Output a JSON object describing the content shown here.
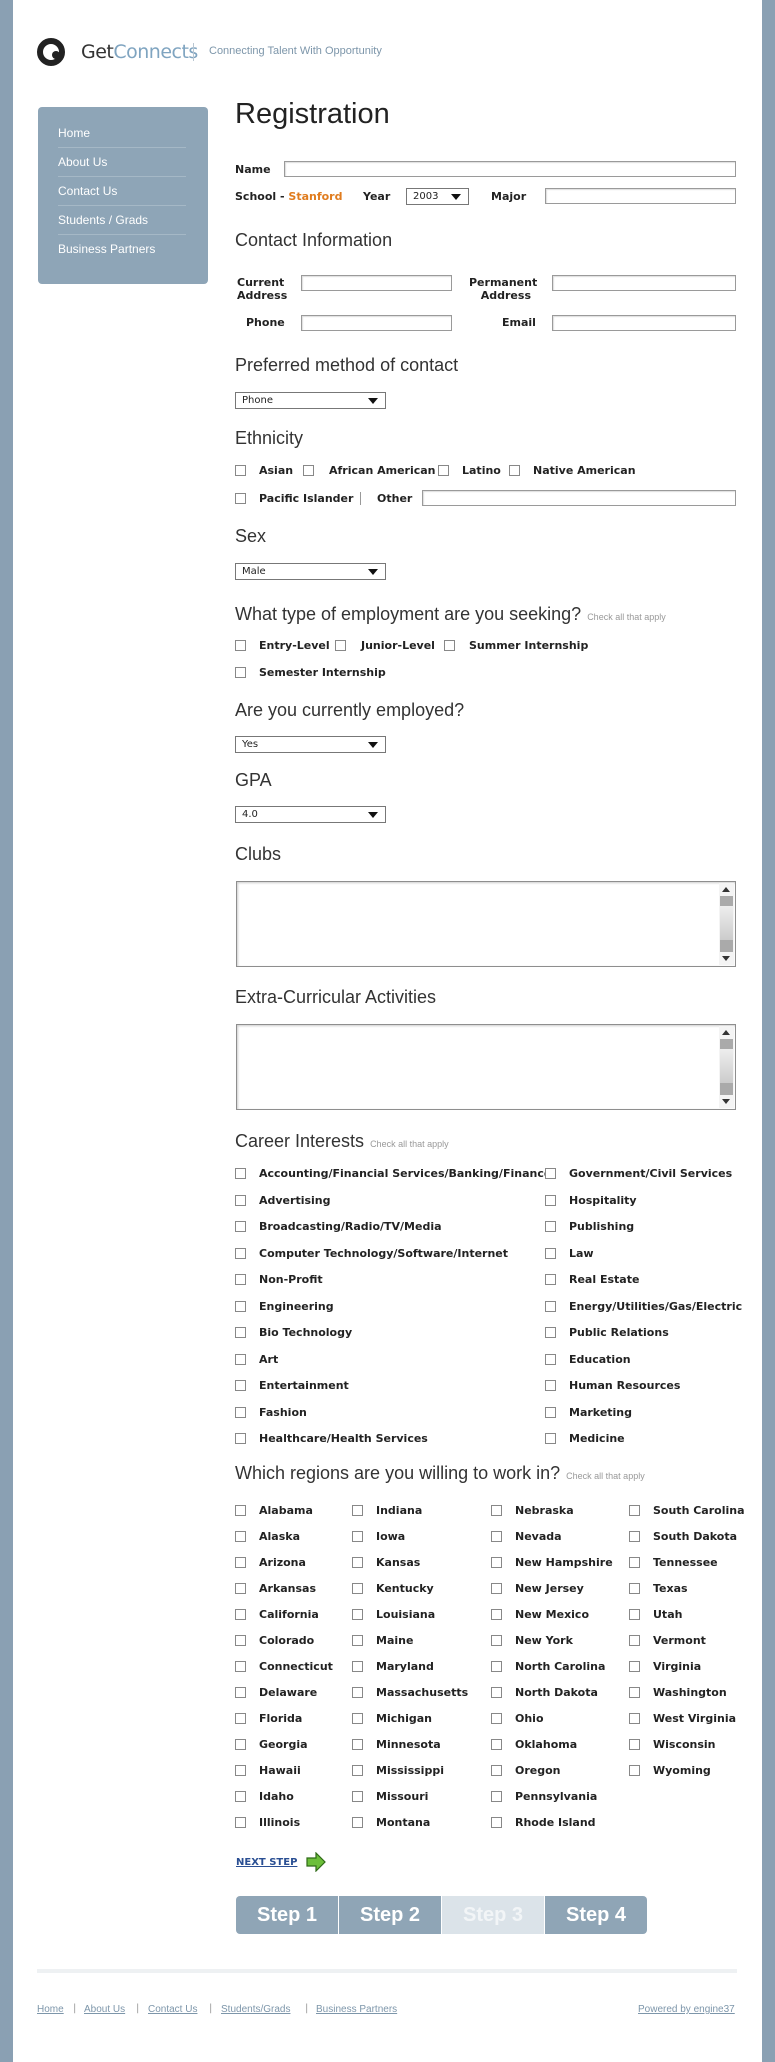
{
  "brand": {
    "logo_get": "Get",
    "logo_connects": "Connects",
    "tagline": "Connecting Talent With Opportunity"
  },
  "sidebar": {
    "items": [
      {
        "label": "Home"
      },
      {
        "label": "About Us"
      },
      {
        "label": "Contact Us"
      },
      {
        "label": "Students / Grads"
      },
      {
        "label": "Business Partners"
      }
    ]
  },
  "form": {
    "title": "Registration",
    "name_label": "Name",
    "school_label": "School - ",
    "school_value": "Stanford",
    "year_label": "Year",
    "year_value": "2003",
    "major_label": "Major",
    "contact": {
      "heading": "Contact Information",
      "current_address_label_1": "Current",
      "current_address_label_2": "Address",
      "permanent_address_label_1": "Permanent",
      "permanent_address_label_2": "Address",
      "phone_label": "Phone",
      "email_label": "Email"
    },
    "preferred": {
      "heading": "Preferred method of contact",
      "value": "Phone"
    },
    "ethnicity": {
      "heading": "Ethnicity",
      "options": [
        "Asian",
        "African American",
        "Latino",
        "Native American",
        "Pacific Islander"
      ],
      "other_label": "Other"
    },
    "sex": {
      "heading": "Sex",
      "value": "Male"
    },
    "employment": {
      "heading": "What type of employment are you seeking?",
      "hint": "Check all that apply",
      "options": [
        "Entry-Level",
        "Junior-Level",
        "Summer Internship",
        "Semester Internship"
      ]
    },
    "employed": {
      "heading": "Are you currently employed?",
      "value": "Yes"
    },
    "gpa": {
      "heading": "GPA",
      "value": "4.0"
    },
    "clubs": {
      "heading": "Clubs"
    },
    "extra": {
      "heading": "Extra-Curricular Activities"
    },
    "career": {
      "heading": "Career Interests",
      "hint": "Check all that apply",
      "left": [
        "Accounting/Financial Services/Banking/Finance",
        "Advertising",
        "Broadcasting/Radio/TV/Media",
        "Computer Technology/Software/Internet",
        "Non-Profit",
        "Engineering",
        " Bio Technology",
        "Art",
        "Entertainment",
        "Fashion",
        "Healthcare/Health Services"
      ],
      "right": [
        "Government/Civil Services",
        "Hospitality",
        "Publishing",
        "Law",
        "Real Estate",
        "Energy/Utilities/Gas/Electric",
        "Public Relations",
        "Education",
        "Human Resources",
        "Marketing",
        "Medicine"
      ]
    },
    "regions": {
      "heading": "Which regions are you willing to work in?",
      "hint": "Check all that apply",
      "col1": [
        "Alabama",
        "Alaska",
        "Arizona",
        "Arkansas",
        "California",
        "Colorado",
        "Connecticut",
        "Delaware",
        "Florida",
        "Georgia",
        "Hawaii",
        "Idaho",
        "Illinois"
      ],
      "col2": [
        "Indiana",
        "Iowa",
        "Kansas",
        "Kentucky",
        "Louisiana",
        "Maine",
        "Maryland",
        "Massachusetts",
        "Michigan",
        "Minnesota",
        "Mississippi",
        "Missouri",
        "Montana"
      ],
      "col3": [
        "Nebraska",
        "Nevada",
        "New Hampshire",
        "New Jersey",
        "New Mexico",
        "New York",
        "North Carolina",
        "North Dakota",
        "Ohio",
        "Oklahoma",
        "Oregon",
        "Pennsylvania",
        "Rhode Island"
      ],
      "col4": [
        "South Carolina",
        "South Dakota",
        "Tennessee",
        "Texas",
        "Utah",
        "Vermont",
        "Virginia",
        "Washington",
        "West Virginia",
        "Wisconsin",
        "Wyoming"
      ]
    },
    "next_step": "NEXT STEP",
    "steps": [
      "Step 1",
      "Step 2",
      "Step 3",
      "Step 4"
    ],
    "current_step": 3
  },
  "footer": {
    "links": [
      "Home",
      "About Us",
      "Contact Us",
      "Students/Grads",
      "Business Partners"
    ],
    "powered": "Powered by engine37"
  },
  "colors": {
    "accent": "#e07c1e",
    "sidebar": "#8ea5b7",
    "link": "#2a4f93",
    "background": "#8aa0b3"
  }
}
